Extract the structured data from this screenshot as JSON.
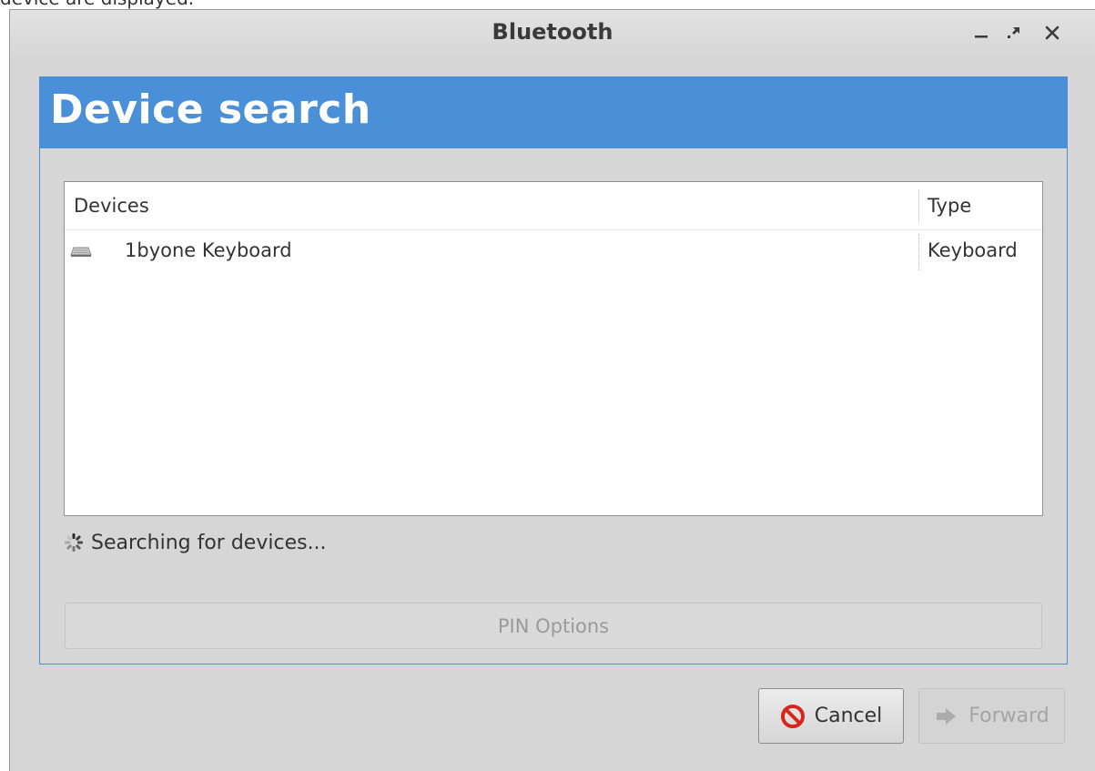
{
  "caption_fragment": "device are displayed.",
  "window": {
    "title": "Bluetooth",
    "controls": [
      "minimize",
      "maximize",
      "close"
    ]
  },
  "page": {
    "title": "Device search"
  },
  "device_list": {
    "columns": [
      "Devices",
      "Type"
    ],
    "rows": [
      {
        "icon": "keyboard-icon",
        "name": "1byone Keyboard",
        "type": "Keyboard"
      }
    ]
  },
  "status": {
    "text": "Searching for devices..."
  },
  "pin_options": {
    "label": "PIN Options",
    "enabled": false
  },
  "buttons": {
    "cancel": {
      "label": "Cancel",
      "icon": "stop-icon"
    },
    "forward": {
      "label": "Forward",
      "icon": "forward-arrow-icon",
      "enabled": false
    }
  },
  "colors": {
    "header_blue": "#4a90d9",
    "window_bg": "#d6d6d6",
    "cancel_icon_red": "#d9261c"
  }
}
